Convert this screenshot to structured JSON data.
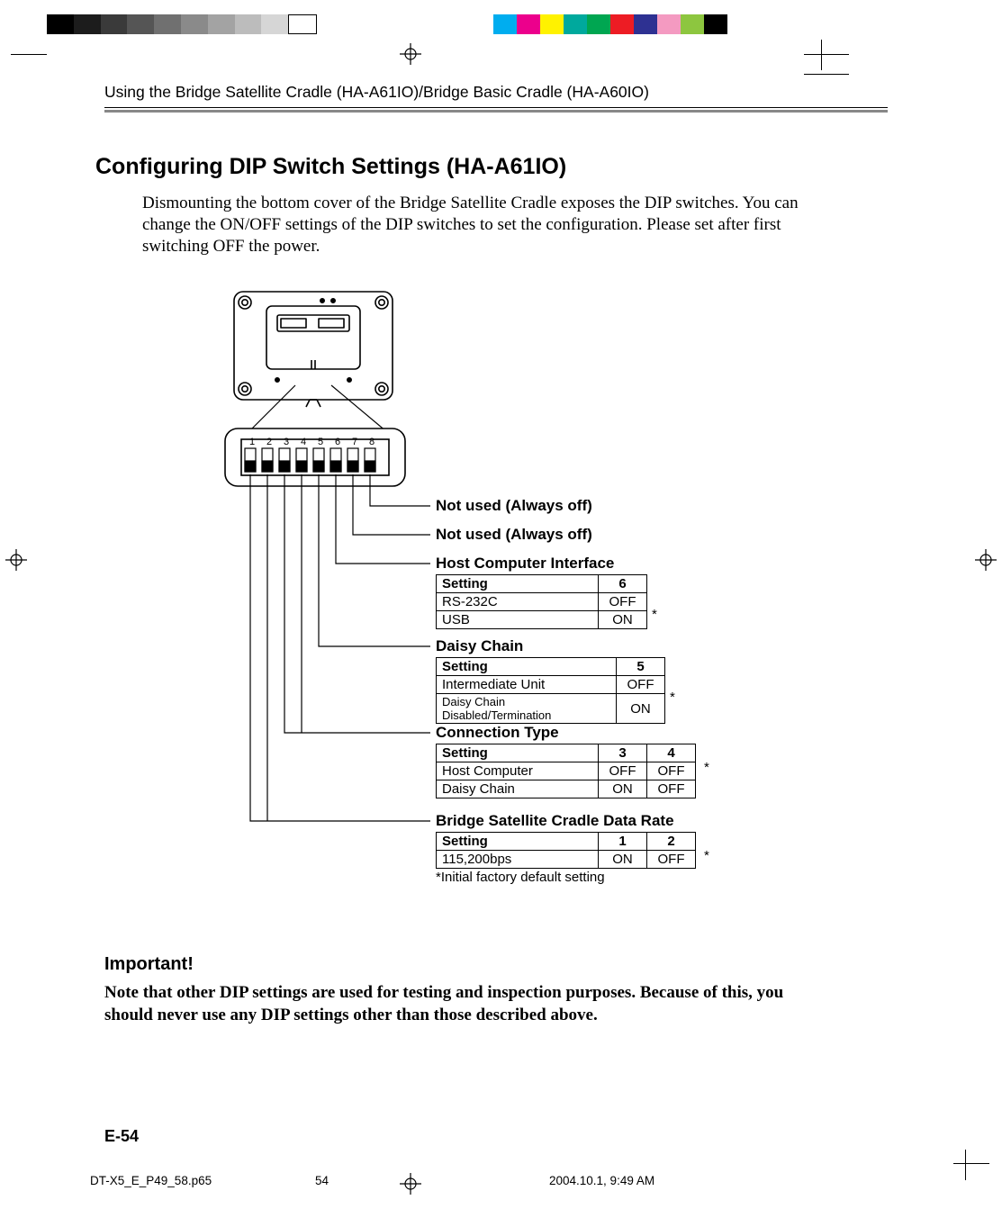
{
  "running_head": "Using the Bridge Satellite Cradle (HA-A61IO)/Bridge Basic Cradle (HA-A60IO)",
  "section_title": "Configuring DIP Switch Settings (HA-A61IO)",
  "intro": "Dismounting the bottom cover of the Bridge Satellite Cradle exposes the DIP switches. You can change the ON/OFF settings of the DIP switches to set the configuration. Please set after first switching OFF the power.",
  "dip_numbers": [
    "1",
    "2",
    "3",
    "4",
    "5",
    "6",
    "7",
    "8"
  ],
  "labels": {
    "not_used_8": "Not used (Always off)",
    "not_used_7": "Not used (Always off)",
    "host_interface": "Host Computer Interface",
    "daisy_chain": "Daisy Chain",
    "connection_type": "Connection Type",
    "data_rate": "Bridge Satellite Cradle Data Rate"
  },
  "tables": {
    "host_interface": {
      "cols": [
        "Setting",
        "6"
      ],
      "rows": [
        {
          "setting": "RS-232C",
          "vals": [
            "OFF"
          ]
        },
        {
          "setting": "USB",
          "vals": [
            "ON"
          ],
          "star": true
        }
      ]
    },
    "daisy_chain": {
      "cols": [
        "Setting",
        "5"
      ],
      "rows": [
        {
          "setting": "Intermediate Unit",
          "vals": [
            "OFF"
          ]
        },
        {
          "setting": "Daisy Chain Disabled/Termination",
          "vals": [
            "ON"
          ],
          "star": true
        }
      ]
    },
    "connection_type": {
      "cols": [
        "Setting",
        "3",
        "4"
      ],
      "rows": [
        {
          "setting": "Host Computer",
          "vals": [
            "OFF",
            "OFF"
          ],
          "star": true
        },
        {
          "setting": "Daisy Chain",
          "vals": [
            "ON",
            "OFF"
          ]
        }
      ]
    },
    "data_rate": {
      "cols": [
        "Setting",
        "1",
        "2"
      ],
      "rows": [
        {
          "setting": "115,200bps",
          "vals": [
            "ON",
            "OFF"
          ],
          "star": true
        }
      ]
    }
  },
  "footnote": "*Initial factory default setting",
  "important_title": "Important!",
  "important_body": "Note that other DIP settings are used for testing and inspection purposes. Because of this, you should never use any DIP settings other than those described above.",
  "page_number": "E-54",
  "slug": {
    "file": "DT-X5_E_P49_58.p65",
    "folio": "54",
    "timestamp": "2004.10.1, 9:49 AM"
  }
}
